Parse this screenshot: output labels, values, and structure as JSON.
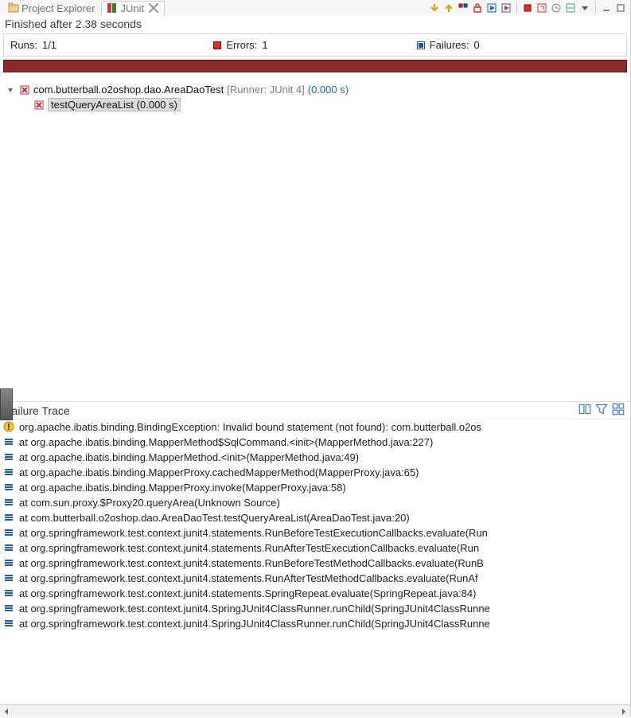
{
  "tabs": {
    "project_explorer": "Project Explorer",
    "junit": "JUnit"
  },
  "status": "Finished after 2.38 seconds",
  "counters": {
    "runs_label": "Runs:",
    "runs_value": "1/1",
    "errors_label": "Errors:",
    "errors_value": "1",
    "failures_label": "Failures:",
    "failures_value": "0"
  },
  "tree": {
    "root_name": "com.butterball.o2oshop.dao.AreaDaoTest",
    "root_meta": "[Runner: JUnit 4]",
    "root_time": "(0.000 s)",
    "child_name": "testQueryAreaList",
    "child_time": "(0.000 s)"
  },
  "failure_trace_title": "Failure Trace",
  "stack": [
    "org.apache.ibatis.binding.BindingException: Invalid bound statement (not found): com.butterball.o2os",
    "at org.apache.ibatis.binding.MapperMethod$SqlCommand.<init>(MapperMethod.java:227)",
    "at org.apache.ibatis.binding.MapperMethod.<init>(MapperMethod.java:49)",
    "at org.apache.ibatis.binding.MapperProxy.cachedMapperMethod(MapperProxy.java:65)",
    "at org.apache.ibatis.binding.MapperProxy.invoke(MapperProxy.java:58)",
    "at com.sun.proxy.$Proxy20.queryArea(Unknown Source)",
    "at com.butterball.o2oshop.dao.AreaDaoTest.testQueryAreaList(AreaDaoTest.java:20)",
    "at org.springframework.test.context.junit4.statements.RunBeforeTestExecutionCallbacks.evaluate(Run",
    "at org.springframework.test.context.junit4.statements.RunAfterTestExecutionCallbacks.evaluate(Run",
    "at org.springframework.test.context.junit4.statements.RunBeforeTestMethodCallbacks.evaluate(RunB",
    "at org.springframework.test.context.junit4.statements.RunAfterTestMethodCallbacks.evaluate(RunAf",
    "at org.springframework.test.context.junit4.statements.SpringRepeat.evaluate(SpringRepeat.java:84)",
    "at org.springframework.test.context.junit4.SpringJUnit4ClassRunner.runChild(SpringJUnit4ClassRunne",
    "at org.springframework.test.context.junit4.SpringJUnit4ClassRunner.runChild(SpringJUnit4ClassRunne"
  ]
}
